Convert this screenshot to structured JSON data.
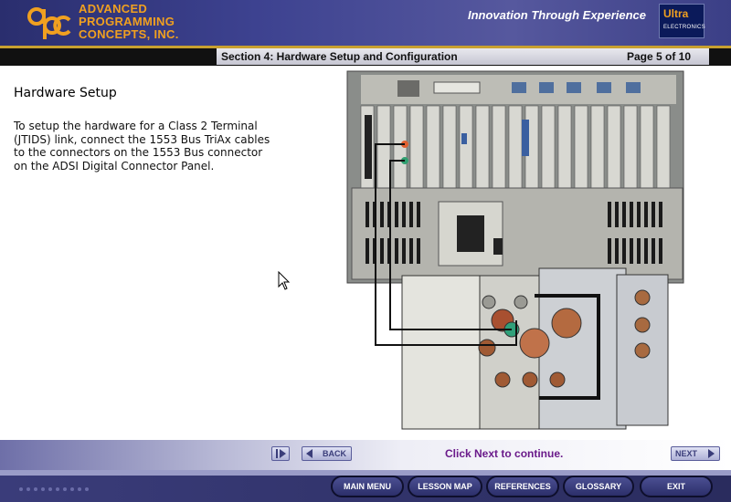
{
  "header": {
    "company_lines": [
      "ADVANCED",
      "PROGRAMMING",
      "CONCEPTS, INC."
    ],
    "tagline": "Innovation Through Experience",
    "partner_logo": {
      "line1": "Ultra",
      "line2": "ELECTRONICS"
    },
    "logo_icon": "apc-logo-icon"
  },
  "section": {
    "title": "Section 4: Hardware Setup and Configuration",
    "page": "Page 5 of 10"
  },
  "content": {
    "heading": "Hardware Setup",
    "body_lines": [
      "To setup the hardware for a Class 2 Terminal",
      "(JTIDS) link, connect the 1553 Bus TriAx cables",
      "to the connectors on the 1553 Bus connector",
      "on the ADSI Digital Connector Panel."
    ],
    "image_icon": "hardware-photo"
  },
  "nav": {
    "replay_icon": "replay-icon",
    "back_label": "BACK",
    "next_label": "NEXT",
    "hint": "Click Next to continue."
  },
  "menu": {
    "main_menu": "MAIN MENU",
    "lesson_map": "LESSON MAP",
    "references": "REFERENCES",
    "glossary": "GLOSSARY",
    "exit": "EXIT"
  },
  "colors": {
    "header_bg": "#3d4290",
    "brand_orange": "#f0a020",
    "hint_purple": "#6a1a8a",
    "menu_button": "#3a3e80"
  }
}
